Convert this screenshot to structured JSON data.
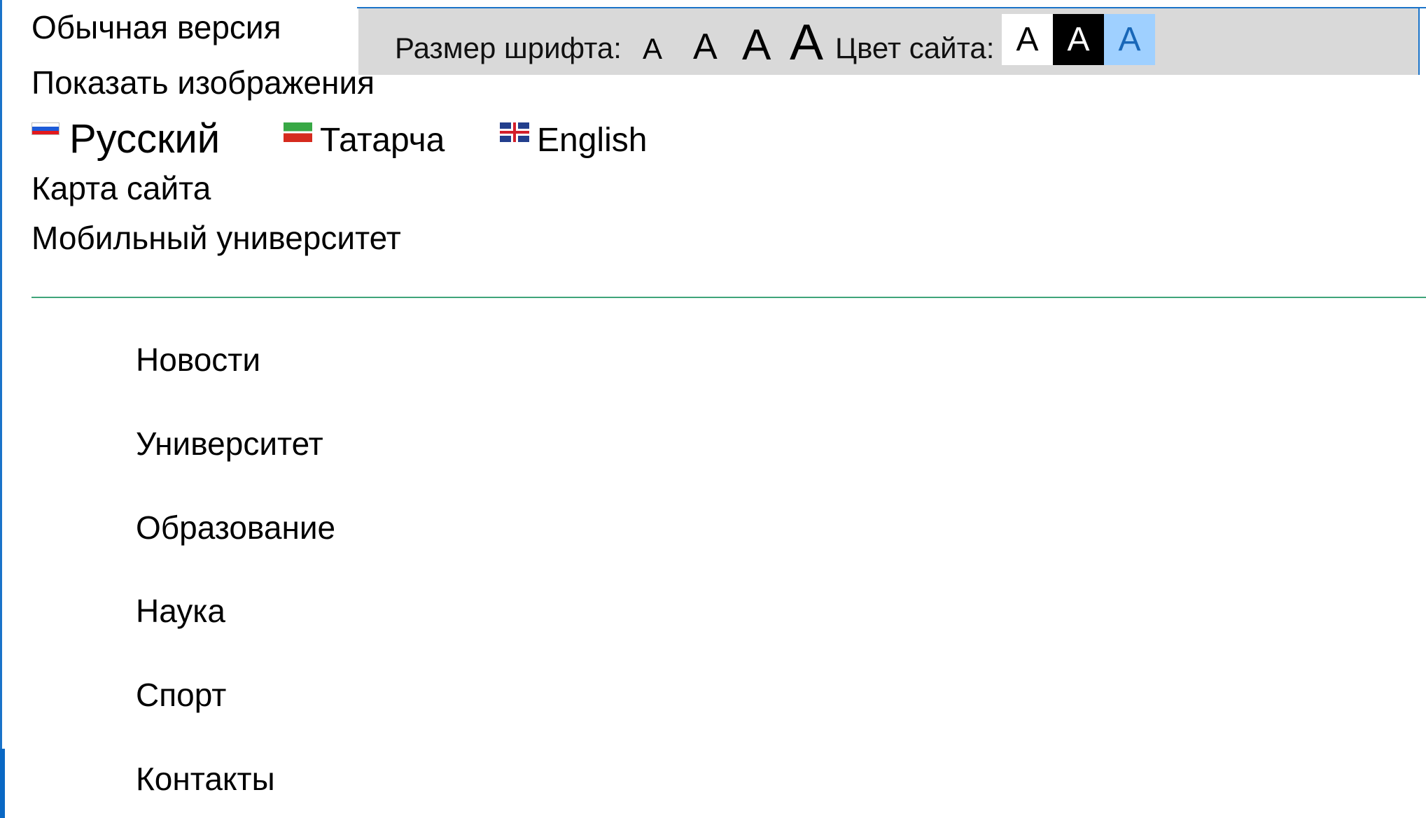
{
  "top_links": {
    "normal_version": "Обычная версия",
    "show_images": "Показать изображения",
    "sitemap": "Карта сайта",
    "mobile_university": "Мобильный университет"
  },
  "accessibility_bar": {
    "font_size_label": "Размер шрифта:",
    "font_size_options": [
      "A",
      "A",
      "A",
      "A"
    ],
    "site_color_label": "Цвет сайта:",
    "color_options": [
      {
        "label": "A",
        "background": "#ffffff",
        "text": "#000000"
      },
      {
        "label": "A",
        "background": "#000000",
        "text": "#ffffff"
      },
      {
        "label": "A",
        "background": "#9fd0ff",
        "text": "#1867b8"
      }
    ]
  },
  "languages": [
    {
      "label": "Русский",
      "flag": "russia-flag-icon"
    },
    {
      "label": "Татарча",
      "flag": "tatarstan-flag-icon"
    },
    {
      "label": "English",
      "flag": "uk-flag-icon"
    }
  ],
  "main_menu": [
    "Новости",
    "Университет",
    "Образование",
    "Наука",
    "Спорт",
    "Контакты"
  ],
  "colors": {
    "frame": "#1a73c9",
    "bar_background": "#d9d9d9",
    "divider": "#3fa47a"
  }
}
